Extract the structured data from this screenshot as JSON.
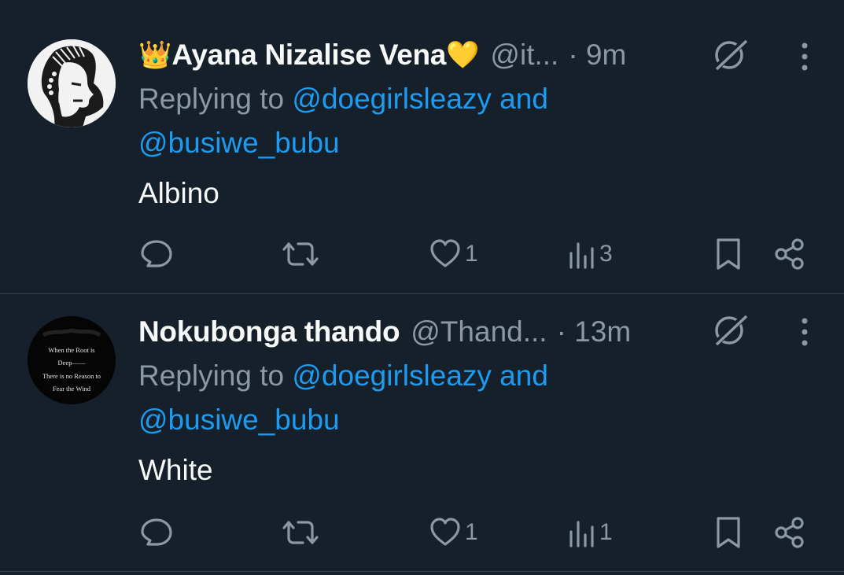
{
  "tweets": [
    {
      "avatar": "woman-silhouette-avatar",
      "name": "Ayana Nizalise Vena",
      "emoji_before": "👑",
      "emoji_after": "💛",
      "handle": "@it...",
      "time": "· 9m",
      "replying_prefix": "Replying to ",
      "mention_1": "@doegirlsleazy",
      "mention_joiner": " and",
      "mention_2": "@busiwe_bubu",
      "text": "Albino",
      "likes": "1",
      "views": "3"
    },
    {
      "avatar": "quote-avatar",
      "avatar_text": [
        "When the Root is",
        "Deep——",
        "There is no Reason to",
        "Fear the Wind"
      ],
      "name": "Nokubonga thando",
      "handle": "@Thand...",
      "time": "· 13m",
      "replying_prefix": "Replying to ",
      "mention_1": "@doegirlsleazy",
      "mention_joiner": " and",
      "mention_2": "@busiwe_bubu",
      "text": "White",
      "likes": "1",
      "views": "1"
    }
  ],
  "icons": {
    "reply": "reply-icon",
    "retweet": "retweet-icon",
    "like": "heart-icon",
    "views": "views-chart-icon",
    "bookmark": "bookmark-icon",
    "share": "share-icon",
    "grok": "grok-icon",
    "more": "more-vertical-icon"
  },
  "colors": {
    "background": "#15202b",
    "text": "#f7f9f9",
    "secondary": "#8b98a5",
    "link": "#1d9bf0",
    "divider": "#38444d"
  }
}
